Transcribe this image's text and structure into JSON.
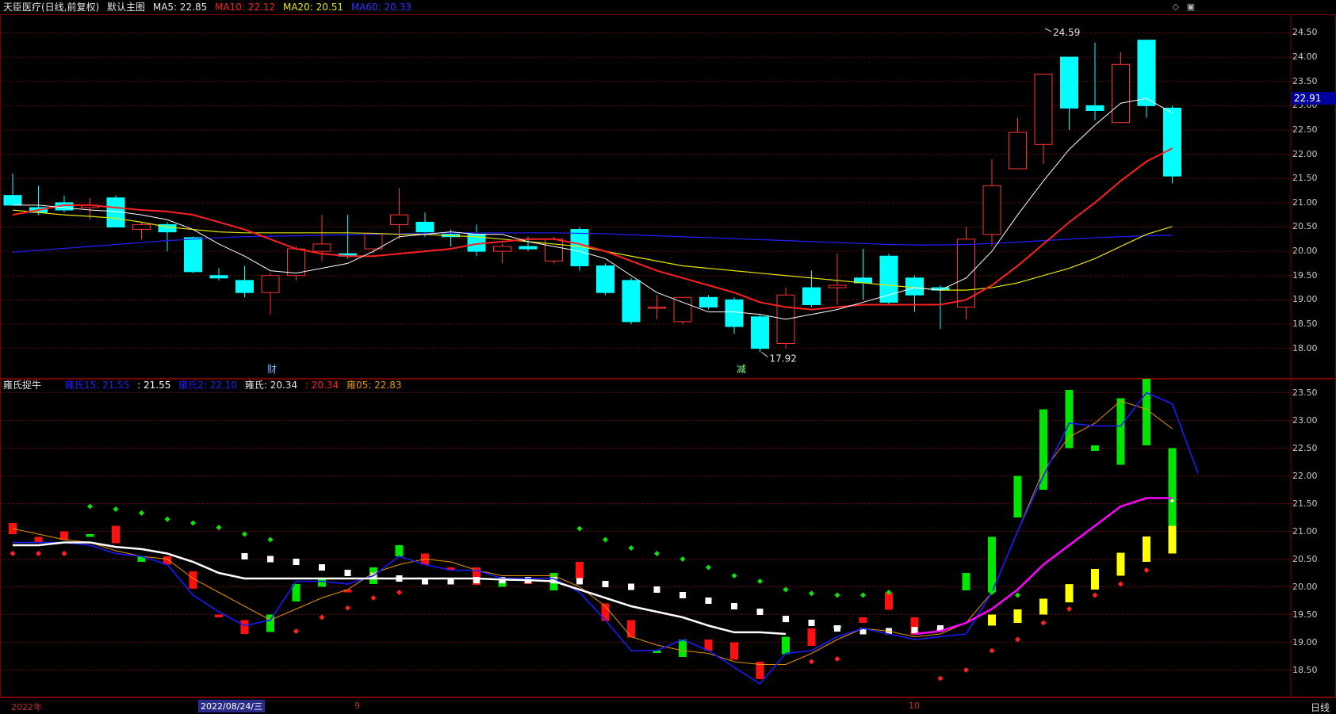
{
  "main_header": {
    "title": "天臣医疗(日线,前复权)",
    "mode": "默认主图",
    "ma5_label": "MA5: 22.85",
    "ma10_label": "MA10: 22.12",
    "ma20_label": "MA20: 20.51",
    "ma60_label": "MA60: 20.33"
  },
  "colors": {
    "bull": "#ff3232",
    "bear": "#00ffff",
    "ma5": "#ffffff",
    "ma10": "#ff2020",
    "ma20": "#e6e600",
    "ma60": "#2020ff",
    "grid": "#7a0000",
    "magenta": "#ff00ff",
    "orange": "#e69500",
    "green": "#00e600",
    "yellow": "#ffff00"
  },
  "top_icons": [
    "diamond-icon",
    "window-icon"
  ],
  "main_axis": {
    "labels": [
      "24.50",
      "24.00",
      "23.50",
      "23.00",
      "22.50",
      "22.00",
      "21.50",
      "21.00",
      "20.50",
      "20.00",
      "19.50",
      "19.00",
      "18.50",
      "18.00"
    ],
    "range": [
      17.7,
      24.85
    ],
    "current_price": "22.91"
  },
  "markers": {
    "high_value": "24.59",
    "low_value": "17.92",
    "cai_label": "财",
    "jian_label": "减"
  },
  "chart_data": [
    {
      "type": "candlestick",
      "title": "天臣医疗(日线,前复权)",
      "candles": [
        {
          "o": 21.15,
          "h": 21.6,
          "l": 20.95,
          "c": 20.95
        },
        {
          "o": 20.9,
          "h": 21.35,
          "l": 20.75,
          "c": 20.8
        },
        {
          "o": 21.0,
          "h": 21.15,
          "l": 20.8,
          "c": 20.85
        },
        {
          "o": 20.9,
          "h": 21.1,
          "l": 20.65,
          "c": 20.95
        },
        {
          "o": 21.1,
          "h": 21.15,
          "l": 20.5,
          "c": 20.5
        },
        {
          "o": 20.45,
          "h": 20.6,
          "l": 20.25,
          "c": 20.55
        },
        {
          "o": 20.55,
          "h": 20.6,
          "l": 20.0,
          "c": 20.4
        },
        {
          "o": 20.28,
          "h": 20.3,
          "l": 19.55,
          "c": 19.58
        },
        {
          "o": 19.5,
          "h": 19.65,
          "l": 19.4,
          "c": 19.45
        },
        {
          "o": 19.4,
          "h": 19.7,
          "l": 19.05,
          "c": 19.15
        },
        {
          "o": 19.15,
          "h": 19.55,
          "l": 18.7,
          "c": 19.5
        },
        {
          "o": 19.5,
          "h": 20.1,
          "l": 19.4,
          "c": 20.05
        },
        {
          "o": 20.0,
          "h": 20.75,
          "l": 19.8,
          "c": 20.15
        },
        {
          "o": 19.95,
          "h": 20.75,
          "l": 19.85,
          "c": 19.9
        },
        {
          "o": 20.05,
          "h": 20.35,
          "l": 19.95,
          "c": 20.35
        },
        {
          "o": 20.55,
          "h": 21.3,
          "l": 20.25,
          "c": 20.75
        },
        {
          "o": 20.6,
          "h": 20.8,
          "l": 20.3,
          "c": 20.4
        },
        {
          "o": 20.35,
          "h": 20.45,
          "l": 20.1,
          "c": 20.3
        },
        {
          "o": 20.35,
          "h": 20.55,
          "l": 19.9,
          "c": 20.0
        },
        {
          "o": 20.0,
          "h": 20.15,
          "l": 19.75,
          "c": 20.1
        },
        {
          "o": 20.1,
          "h": 20.3,
          "l": 20.0,
          "c": 20.05
        },
        {
          "o": 19.8,
          "h": 20.3,
          "l": 19.75,
          "c": 20.25
        },
        {
          "o": 20.45,
          "h": 20.5,
          "l": 19.6,
          "c": 19.7
        },
        {
          "o": 19.7,
          "h": 19.75,
          "l": 19.1,
          "c": 19.15
        },
        {
          "o": 19.4,
          "h": 19.45,
          "l": 18.5,
          "c": 18.55
        },
        {
          "o": 18.85,
          "h": 19.1,
          "l": 18.6,
          "c": 18.85
        },
        {
          "o": 18.55,
          "h": 19.05,
          "l": 18.5,
          "c": 19.05
        },
        {
          "o": 19.05,
          "h": 19.1,
          "l": 18.8,
          "c": 18.85
        },
        {
          "o": 19.0,
          "h": 19.05,
          "l": 18.3,
          "c": 18.45
        },
        {
          "o": 18.65,
          "h": 18.7,
          "l": 17.92,
          "c": 18.0
        },
        {
          "o": 18.1,
          "h": 19.25,
          "l": 18.0,
          "c": 19.1
        },
        {
          "o": 19.25,
          "h": 19.6,
          "l": 18.85,
          "c": 18.9
        },
        {
          "o": 19.25,
          "h": 19.95,
          "l": 18.9,
          "c": 19.3
        },
        {
          "o": 19.45,
          "h": 20.05,
          "l": 19.0,
          "c": 19.35
        },
        {
          "o": 19.9,
          "h": 19.95,
          "l": 18.9,
          "c": 18.95
        },
        {
          "o": 19.45,
          "h": 19.5,
          "l": 18.75,
          "c": 19.1
        },
        {
          "o": 19.25,
          "h": 19.3,
          "l": 18.4,
          "c": 19.2
        },
        {
          "o": 18.85,
          "h": 20.5,
          "l": 18.6,
          "c": 20.25
        },
        {
          "o": 20.35,
          "h": 21.9,
          "l": 20.1,
          "c": 21.35
        },
        {
          "o": 21.7,
          "h": 22.75,
          "l": 21.7,
          "c": 22.45
        },
        {
          "o": 22.2,
          "h": 23.65,
          "l": 21.8,
          "c": 23.65
        },
        {
          "o": 24.0,
          "h": 24.0,
          "l": 22.5,
          "c": 22.95
        },
        {
          "o": 23.0,
          "h": 24.3,
          "l": 22.7,
          "c": 22.9
        },
        {
          "o": 22.65,
          "h": 24.1,
          "l": 22.65,
          "c": 23.85
        },
        {
          "o": 24.35,
          "h": 24.35,
          "l": 22.75,
          "c": 23.0
        },
        {
          "o": 22.95,
          "h": 23.0,
          "l": 21.4,
          "c": 21.55
        }
      ],
      "ma5": [
        20.95,
        20.95,
        20.9,
        20.85,
        20.82,
        20.75,
        20.65,
        20.45,
        20.15,
        19.9,
        19.6,
        19.55,
        19.65,
        19.75,
        20.0,
        20.3,
        20.35,
        20.4,
        20.35,
        20.35,
        20.2,
        20.1,
        20.0,
        19.85,
        19.5,
        19.15,
        18.95,
        18.75,
        18.75,
        18.7,
        18.6,
        18.7,
        18.8,
        18.95,
        19.1,
        19.25,
        19.2,
        19.45,
        20.0,
        20.75,
        21.45,
        22.1,
        22.6,
        23.05,
        23.15,
        22.85
      ],
      "ma10": [
        20.75,
        20.85,
        20.95,
        20.95,
        20.9,
        20.85,
        20.82,
        20.75,
        20.6,
        20.45,
        20.25,
        20.05,
        19.95,
        19.9,
        19.9,
        19.95,
        20.0,
        20.05,
        20.15,
        20.2,
        20.25,
        20.25,
        20.15,
        20.0,
        19.8,
        19.6,
        19.45,
        19.3,
        19.15,
        18.95,
        18.85,
        18.8,
        18.85,
        18.9,
        18.9,
        18.9,
        18.9,
        19.0,
        19.3,
        19.7,
        20.15,
        20.6,
        21.0,
        21.45,
        21.85,
        22.12
      ],
      "ma20": [
        20.85,
        20.8,
        20.75,
        20.72,
        20.68,
        20.6,
        20.5,
        20.45,
        20.4,
        20.38,
        20.38,
        20.38,
        20.38,
        20.38,
        20.37,
        20.35,
        20.35,
        20.32,
        20.3,
        20.25,
        20.2,
        20.15,
        20.1,
        20.0,
        19.9,
        19.8,
        19.7,
        19.65,
        19.6,
        19.55,
        19.5,
        19.45,
        19.4,
        19.35,
        19.3,
        19.25,
        19.2,
        19.2,
        19.25,
        19.35,
        19.5,
        19.65,
        19.85,
        20.1,
        20.35,
        20.51
      ],
      "ma60": [
        19.98,
        20.02,
        20.06,
        20.1,
        20.14,
        20.18,
        20.22,
        20.25,
        20.28,
        20.3,
        20.31,
        20.32,
        20.33,
        20.34,
        20.35,
        20.36,
        20.37,
        20.38,
        20.38,
        20.38,
        20.38,
        20.38,
        20.37,
        20.36,
        20.34,
        20.32,
        20.3,
        20.28,
        20.26,
        20.24,
        20.22,
        20.2,
        20.18,
        20.16,
        20.14,
        20.13,
        20.13,
        20.14,
        20.16,
        20.19,
        20.22,
        20.25,
        20.28,
        20.3,
        20.32,
        20.33
      ]
    },
    {
      "type": "line",
      "title": "雍氏捉牛",
      "legend": [
        "雍氏15: 21.55",
        ": 21.55",
        "雍氏2: 22.10",
        "雍氏: 20.34",
        ": 20.34",
        "雍05: 22.83"
      ],
      "y_labels": [
        "23.50",
        "23.00",
        "22.50",
        "22.00",
        "21.50",
        "21.00",
        "20.50",
        "20.00",
        "19.50",
        "19.00",
        "18.50"
      ],
      "ylim": [
        18.15,
        23.75
      ],
      "blue": [
        20.8,
        20.8,
        20.8,
        20.75,
        20.6,
        20.55,
        20.4,
        19.85,
        19.55,
        19.3,
        19.4,
        20.1,
        20.1,
        20.05,
        20.2,
        20.55,
        20.4,
        20.3,
        20.3,
        20.15,
        20.15,
        20.15,
        19.9,
        19.4,
        18.85,
        18.85,
        19.05,
        18.85,
        18.55,
        18.25,
        18.8,
        18.85,
        19.1,
        19.25,
        19.15,
        19.05,
        19.1,
        19.15,
        19.9,
        21.0,
        22.0,
        22.95,
        22.9,
        22.9,
        23.5,
        23.3,
        22.05
      ],
      "orange": [
        21.05,
        20.95,
        20.85,
        20.8,
        20.65,
        20.55,
        20.5,
        20.15,
        19.9,
        19.65,
        19.4,
        19.6,
        19.8,
        19.95,
        20.25,
        20.4,
        20.5,
        20.45,
        20.3,
        20.2,
        20.2,
        20.2,
        20.0,
        19.65,
        19.1,
        18.95,
        18.85,
        18.8,
        18.65,
        18.6,
        18.6,
        18.8,
        19.05,
        19.25,
        19.2,
        19.1,
        19.15,
        19.35,
        19.9,
        21.0,
        22.1,
        22.7,
        22.95,
        23.35,
        23.2,
        22.85
      ],
      "white": [
        20.75,
        20.75,
        20.8,
        20.8,
        20.72,
        20.68,
        20.6,
        20.45,
        20.25,
        20.15,
        20.15,
        null,
        null,
        null,
        null,
        null,
        null,
        null,
        20.15,
        20.13,
        20.12,
        20.1,
        19.95,
        19.8,
        19.65,
        19.55,
        19.45,
        19.3,
        19.18,
        19.18,
        19.15
      ],
      "magenta": [
        19.15,
        19.2,
        19.35,
        19.6,
        19.95,
        20.4,
        20.75,
        21.1,
        21.45,
        21.6,
        21.6
      ],
      "magenta_start": 35,
      "green_points": [
        21.45,
        21.4,
        21.33,
        21.22,
        21.15,
        21.07,
        20.95,
        20.85,
        null,
        null,
        null,
        null,
        null,
        null,
        null,
        null,
        null,
        null,
        null,
        21.05,
        20.85,
        20.7,
        20.6,
        20.5,
        20.35,
        20.2,
        20.1,
        19.95,
        19.88,
        19.85,
        19.85,
        19.9,
        null,
        null,
        null,
        19.9,
        19.85
      ],
      "red_points": [
        20.6,
        20.6,
        20.6,
        null,
        null,
        null,
        null,
        null,
        null,
        null,
        null,
        19.2,
        19.45,
        19.62,
        19.8,
        19.9,
        null,
        null,
        null,
        null,
        null,
        null,
        null,
        null,
        null,
        null,
        null,
        null,
        null,
        null,
        null,
        18.65,
        18.7,
        null,
        null,
        null,
        18.35,
        18.5,
        18.85,
        19.05,
        19.35,
        19.6,
        19.85,
        20.05,
        20.3
      ]
    }
  ],
  "sub_header": {
    "title": "雍氏捉牛",
    "l1": "雍氏15: 21.55",
    "l2": ": 21.55",
    "l3": "雍氏2: 22.10",
    "l4": "雍氏: 20.34",
    "l5": ": 20.34",
    "l6": "雍05: 22.83"
  },
  "footer": {
    "year": "2022年",
    "selected_date": "2022/08/24/三",
    "m9": "9",
    "m10": "10",
    "period": "日线"
  }
}
